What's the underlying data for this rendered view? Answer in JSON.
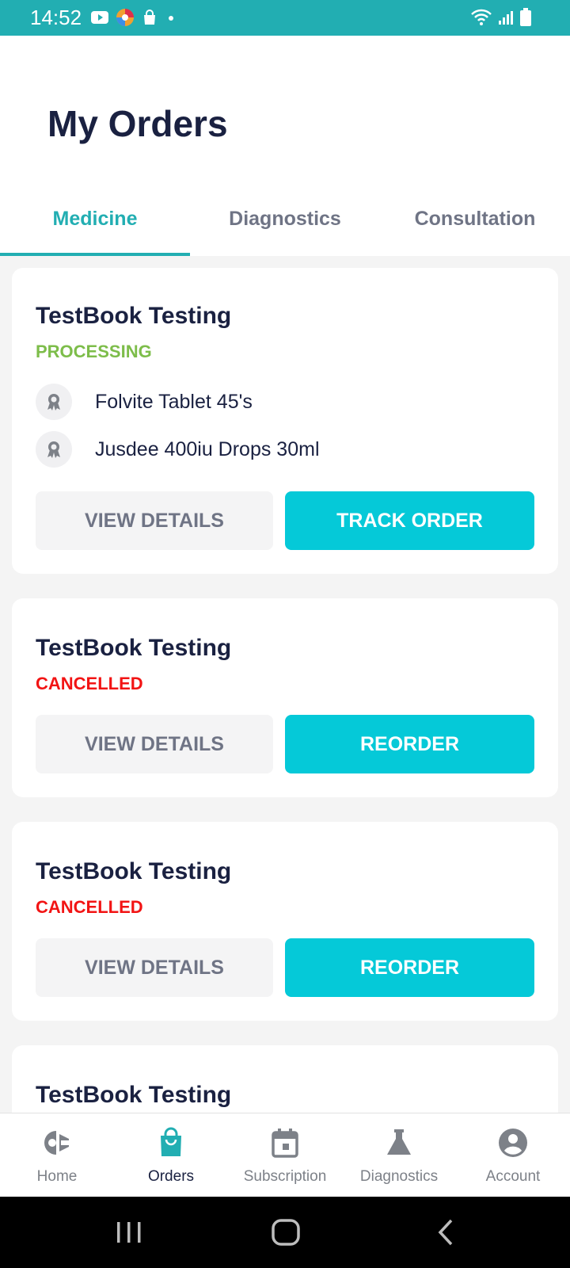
{
  "status_bar": {
    "time": "14:52"
  },
  "header": {
    "title": "My Orders"
  },
  "tabs": [
    {
      "label": "Medicine"
    },
    {
      "label": "Diagnostics"
    },
    {
      "label": "Consultation"
    }
  ],
  "orders": [
    {
      "name": "TestBook Testing",
      "status": "PROCESSING",
      "items": [
        "Folvite Tablet 45's",
        "Jusdee 400iu Drops 30ml"
      ],
      "secondary_label": "VIEW DETAILS",
      "primary_label": "TRACK ORDER"
    },
    {
      "name": "TestBook Testing",
      "status": "CANCELLED",
      "secondary_label": "VIEW DETAILS",
      "primary_label": "REORDER"
    },
    {
      "name": "TestBook Testing",
      "status": "CANCELLED",
      "secondary_label": "VIEW DETAILS",
      "primary_label": "REORDER"
    },
    {
      "name": "TestBook Testing"
    }
  ],
  "bottom_nav": [
    {
      "label": "Home",
      "icon": "home-icon"
    },
    {
      "label": "Orders",
      "icon": "bag-icon"
    },
    {
      "label": "Subscription",
      "icon": "calendar-icon"
    },
    {
      "label": "Diagnostics",
      "icon": "flask-icon"
    },
    {
      "label": "Account",
      "icon": "account-icon"
    }
  ],
  "colors": {
    "accent": "#22aeb2",
    "primary_button": "#05c9d8",
    "processing": "#7dbd4a",
    "cancelled": "#f21414",
    "title": "#1a2141"
  }
}
